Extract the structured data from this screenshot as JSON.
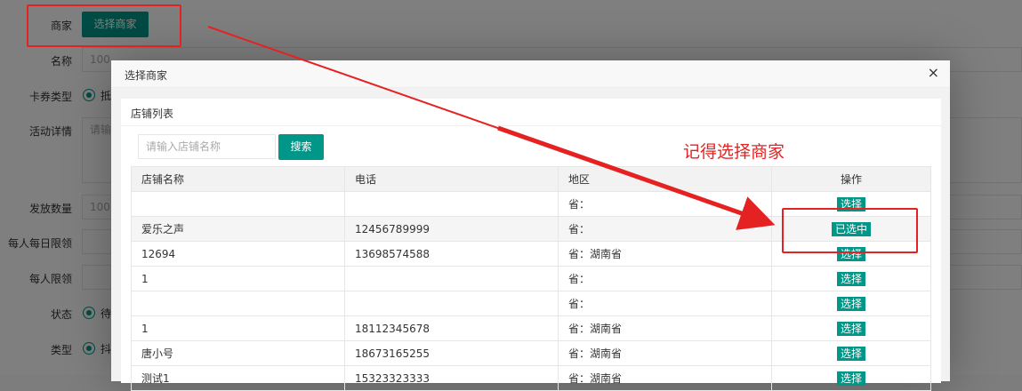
{
  "form": {
    "merchant_label": "商家",
    "merchant_button": "选择商家",
    "name_label": "名称",
    "name_placeholder": "100",
    "card_type_label": "卡券类型",
    "card_type_option": "抵",
    "activity_label": "活动详情",
    "activity_placeholder": "请输",
    "issue_qty_label": "发放数量",
    "issue_qty_placeholder": "100",
    "daily_limit_label": "每人每日限领",
    "person_limit_label": "每人限领",
    "status_label": "状态",
    "status_option": "待",
    "type_label": "类型",
    "type_option": "抖"
  },
  "modal": {
    "title": "选择商家",
    "close": "×",
    "card_title": "店铺列表",
    "search_placeholder": "请输入店铺名称",
    "search_button": "搜索",
    "columns": [
      "店铺名称",
      "电话",
      "地区",
      "操作"
    ],
    "rows": [
      {
        "name": "",
        "phone": "",
        "region": "省：",
        "action": "选择"
      },
      {
        "name": "爱乐之声",
        "phone": "12456789999",
        "region": "省：",
        "action": "已选中"
      },
      {
        "name": "12694",
        "phone": "13698574588",
        "region": "省：湖南省",
        "action": "选择"
      },
      {
        "name": "1",
        "phone": "",
        "region": "省：",
        "action": "选择"
      },
      {
        "name": "",
        "phone": "",
        "region": "省：",
        "action": "选择"
      },
      {
        "name": "1",
        "phone": "18112345678",
        "region": "省：湖南省",
        "action": "选择"
      },
      {
        "name": "唐小号",
        "phone": "18673165255",
        "region": "省：湖南省",
        "action": "选择"
      },
      {
        "name": "测试1",
        "phone": "15323323333",
        "region": "省：湖南省",
        "action": "选择"
      }
    ]
  },
  "annotation": {
    "text": "记得选择商家",
    "color": "#e52222"
  },
  "colors": {
    "accent": "#009688"
  }
}
